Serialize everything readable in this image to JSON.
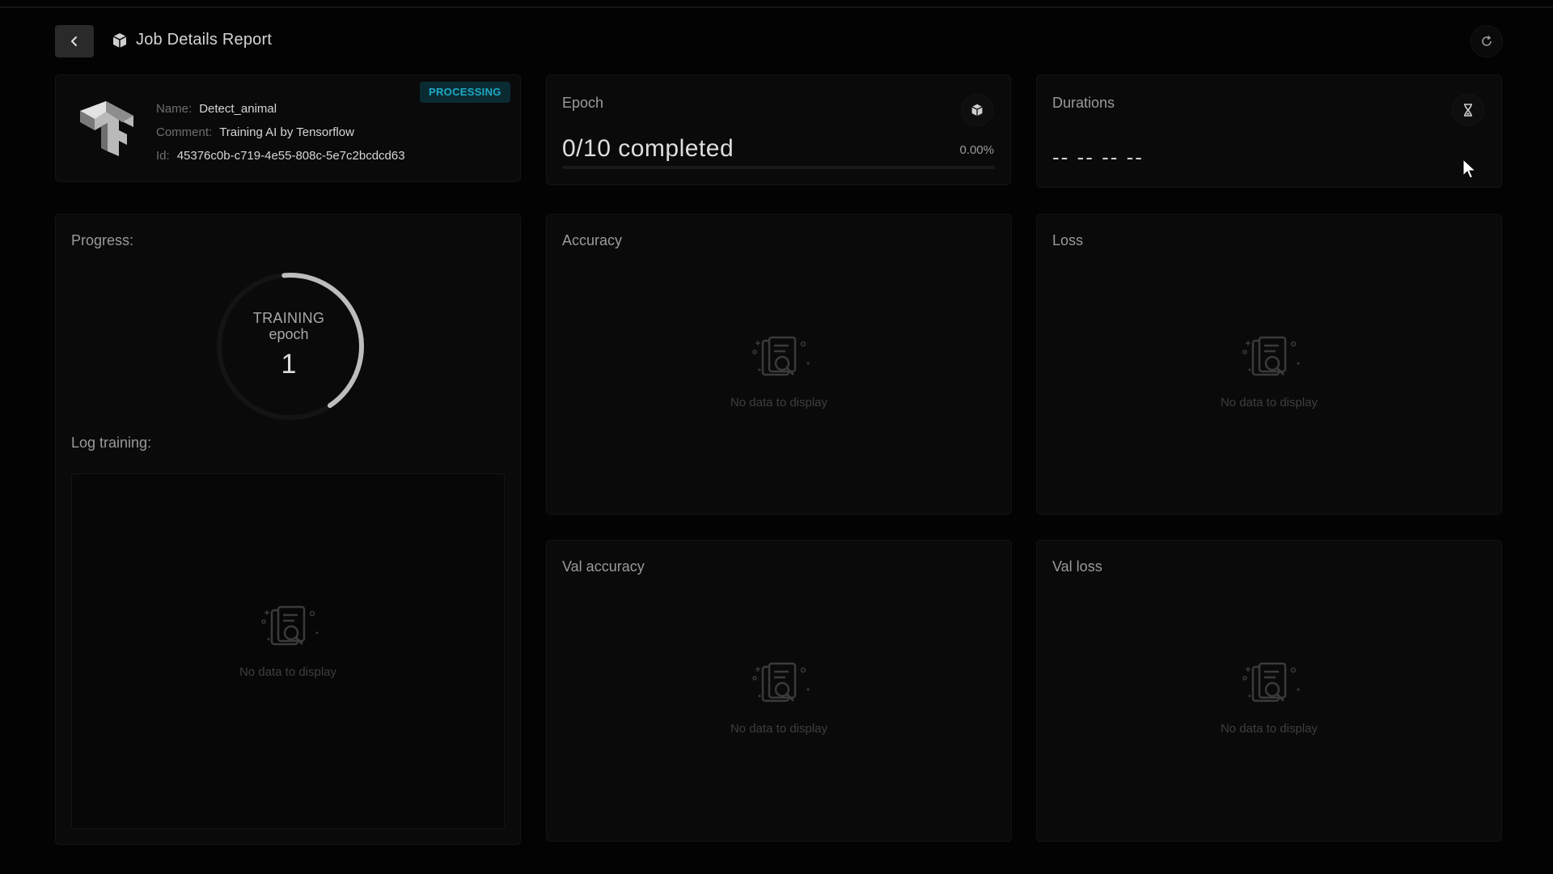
{
  "header": {
    "title": "Job Details Report",
    "back_icon": "chevron-left-icon",
    "title_icon": "cube-icon",
    "refresh_icon": "refresh-icon"
  },
  "job": {
    "name_label": "Name:",
    "name": "Detect_animal",
    "comment_label": "Comment:",
    "comment": "Training AI by Tensorflow",
    "id_label": "Id:",
    "id": "45376c0b-c719-4e55-808c-5e7c2bcdcd63",
    "status": "PROCESSING",
    "status_color": "#1fa9c4",
    "logo_icon": "tensorflow-logo"
  },
  "epoch": {
    "title": "Epoch",
    "value": "0/10 completed",
    "percent": "0.00%",
    "progress": 0,
    "icon": "cube-icon"
  },
  "durations": {
    "title": "Durations",
    "value": "-- -- -- --",
    "icon": "hourglass-icon"
  },
  "progress": {
    "title": "Progress:",
    "state": "TRAINING",
    "unit": "epoch",
    "value": "1",
    "gauge_fraction": 0.42,
    "log_title": "Log training:",
    "log_empty": "No data to display"
  },
  "charts": {
    "accuracy": {
      "title": "Accuracy",
      "empty": "No data to display"
    },
    "loss": {
      "title": "Loss",
      "empty": "No data to display"
    },
    "val_accuracy": {
      "title": "Val accuracy",
      "empty": "No data to display"
    },
    "val_loss": {
      "title": "Val loss",
      "empty": "No data to display"
    }
  }
}
